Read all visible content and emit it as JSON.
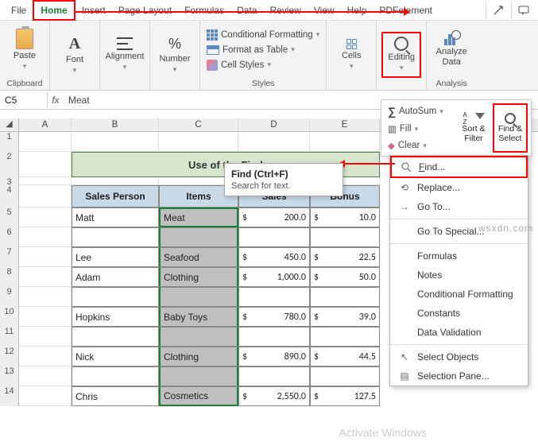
{
  "tabs": [
    "File",
    "Home",
    "Insert",
    "Page Layout",
    "Formulas",
    "Data",
    "Review",
    "View",
    "Help",
    "PDFelement"
  ],
  "ribbon": {
    "clipboard": {
      "paste": "Paste",
      "label": "Clipboard"
    },
    "font": {
      "btn": "Font"
    },
    "alignment": {
      "btn": "Alignment"
    },
    "number": {
      "btn": "Number"
    },
    "styles": {
      "cond": "Conditional Formatting",
      "table": "Format as Table",
      "cellstyles": "Cell Styles",
      "label": "Styles"
    },
    "cells": {
      "btn": "Cells"
    },
    "editing": {
      "btn": "Editing"
    },
    "analysis": {
      "btn": "Analyze Data",
      "label": "Analysis"
    }
  },
  "editpanel": {
    "autosum": "AutoSum",
    "fill": "Fill",
    "clear": "Clear",
    "sort": "Sort & Filter",
    "find": "Find & Select"
  },
  "fbar": {
    "name": "C5",
    "value": "Meat"
  },
  "cols": [
    "A",
    "B",
    "C",
    "D",
    "E"
  ],
  "title": "Use of the Find",
  "headers": [
    "Sales Person",
    "Items",
    "Sales",
    "Bonus"
  ],
  "rows": [
    {
      "person": "Matt",
      "item": "Meat",
      "sales": "200.0",
      "bonus": "10.0"
    },
    {
      "person": "",
      "item": "",
      "sales": "",
      "bonus": ""
    },
    {
      "person": "Lee",
      "item": "Seafood",
      "sales": "450.0",
      "bonus": "22.5"
    },
    {
      "person": "Adam",
      "item": "Clothing",
      "sales": "1,000.0",
      "bonus": "50.0"
    },
    {
      "person": "",
      "item": "",
      "sales": "",
      "bonus": ""
    },
    {
      "person": "Hopkins",
      "item": "Baby Toys",
      "sales": "780.0",
      "bonus": "39.0"
    },
    {
      "person": "",
      "item": "",
      "sales": "",
      "bonus": ""
    },
    {
      "person": "Nick",
      "item": "Clothing",
      "sales": "890.0",
      "bonus": "44.5"
    },
    {
      "person": "",
      "item": "",
      "sales": "",
      "bonus": ""
    },
    {
      "person": "Chris",
      "item": "Cosmetics",
      "sales": "2,550.0",
      "bonus": "127.5"
    }
  ],
  "tooltip": {
    "title": "Find (Ctrl+F)",
    "body": "Search for text."
  },
  "menu": {
    "find": "Find...",
    "replace": "Replace...",
    "goto": "Go To...",
    "special": "Go To Special...",
    "formulas": "Formulas",
    "notes": "Notes",
    "cond": "Conditional Formatting",
    "constants": "Constants",
    "datav": "Data Validation",
    "selobj": "Select Objects",
    "selpane": "Selection Pane..."
  },
  "watermark": "wsxdn.com",
  "activate": "Activate Windows"
}
